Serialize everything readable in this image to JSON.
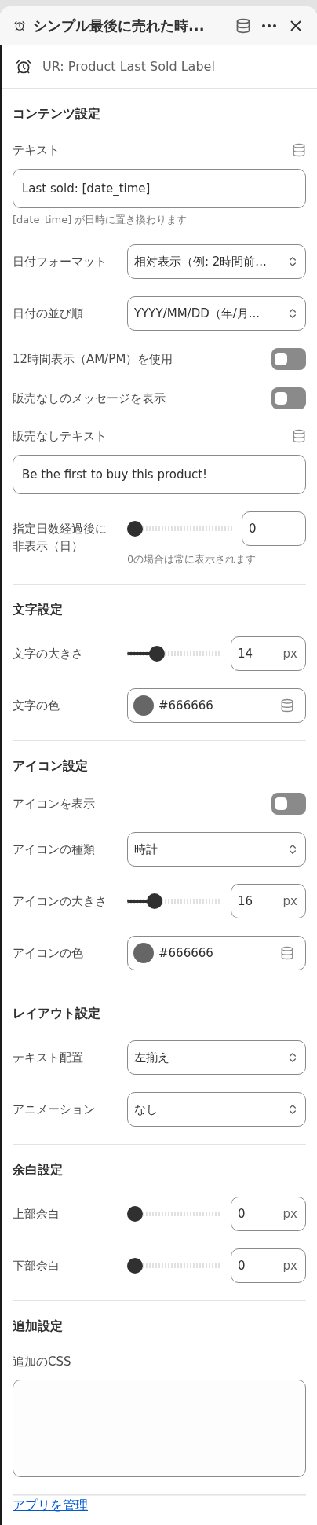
{
  "header": {
    "title": "シンプル最後に売れた時..."
  },
  "app": {
    "name": "UR: Product Last Sold Label"
  },
  "sections": [
    {
      "title": "コンテンツ設定",
      "fields": [
        {
          "kind": "text",
          "label": "テキスト",
          "value": "Last sold: [date_time]",
          "hint": "[date_time] が日時に置き換わります"
        },
        {
          "kind": "select",
          "label": "日付フォーマット",
          "value": "相対表示（例: 2時間前..."
        },
        {
          "kind": "select",
          "label": "日付の並び順",
          "value": "YYYY/MM/DD（年/月..."
        },
        {
          "kind": "toggle",
          "label": "12時間表示（AM/PM）を使用",
          "on": false
        },
        {
          "kind": "toggle",
          "label": "販売なしのメッセージを表示",
          "on": false
        },
        {
          "kind": "text",
          "label": "販売なしテキスト",
          "value": "Be the first to buy this product!"
        },
        {
          "kind": "slider",
          "label": "指定日数経過後に非表示（日）",
          "level": 0,
          "value": "0",
          "hint": "0の場合は常に表示されます"
        }
      ]
    },
    {
      "title": "文字設定",
      "fields": [
        {
          "kind": "slider",
          "label": "文字の大きさ",
          "level": 0.28,
          "value": "14",
          "unit": "px"
        },
        {
          "kind": "color",
          "label": "文字の色",
          "value": "#666666",
          "color": "#666666"
        }
      ]
    },
    {
      "title": "アイコン設定",
      "fields": [
        {
          "kind": "toggle",
          "label": "アイコンを表示",
          "on": false
        },
        {
          "kind": "select",
          "label": "アイコンの種類",
          "value": "時計"
        },
        {
          "kind": "slider",
          "label": "アイコンの大きさ",
          "level": 0.25,
          "value": "16",
          "unit": "px"
        },
        {
          "kind": "color",
          "label": "アイコンの色",
          "value": "#666666",
          "color": "#666666"
        }
      ]
    },
    {
      "title": "レイアウト設定",
      "fields": [
        {
          "kind": "select",
          "label": "テキスト配置",
          "value": "左揃え"
        },
        {
          "kind": "select",
          "label": "アニメーション",
          "value": "なし"
        }
      ]
    },
    {
      "title": "余白設定",
      "fields": [
        {
          "kind": "slider",
          "label": "上部余白",
          "level": 0,
          "value": "0",
          "unit": "px"
        },
        {
          "kind": "slider",
          "label": "下部余白",
          "level": 0,
          "value": "0",
          "unit": "px"
        }
      ]
    },
    {
      "title": "追加設定",
      "fields": [
        {
          "kind": "textarea",
          "label": "追加のCSS"
        }
      ]
    }
  ],
  "footer": {
    "link": "アプリを管理"
  }
}
